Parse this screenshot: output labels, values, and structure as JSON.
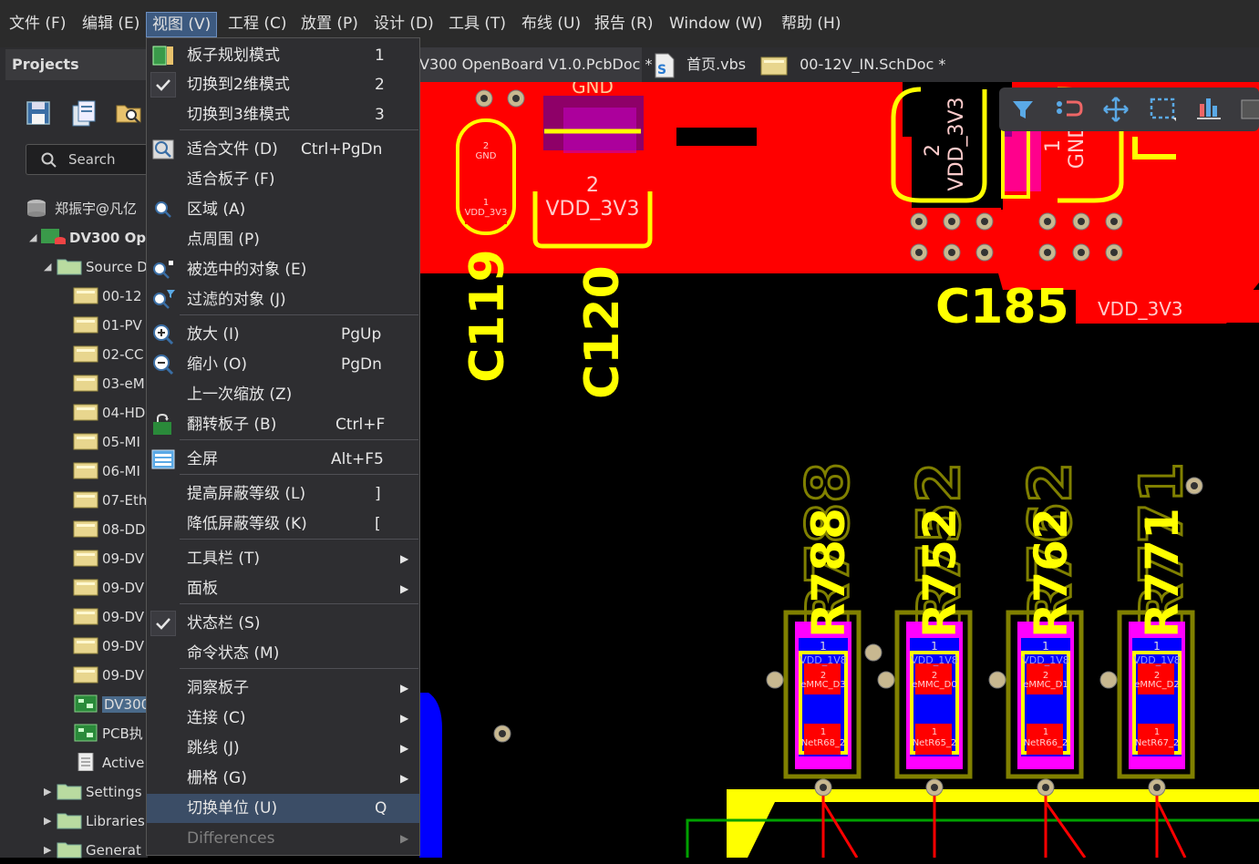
{
  "menubar": {
    "items": [
      "文件 (F)",
      "编辑 (E)",
      "视图 (V)",
      "工程 (C)",
      "放置 (P)",
      "设计 (D)",
      "工具 (T)",
      "布线 (U)",
      "报告 (R)",
      "Window (W)",
      "帮助 (H)"
    ]
  },
  "projects": {
    "title": "Projects",
    "search_placeholder": "Search",
    "tree": [
      {
        "label": "郑振宇@凡亿",
        "level": 0
      },
      {
        "label": "DV300 Op",
        "level": 1
      },
      {
        "label": "Source D",
        "level": 2
      },
      {
        "label": "00-12",
        "level": 3
      },
      {
        "label": "01-PV",
        "level": 3
      },
      {
        "label": "02-CC",
        "level": 3
      },
      {
        "label": "03-eM",
        "level": 3
      },
      {
        "label": "04-HD",
        "level": 3
      },
      {
        "label": "05-MI",
        "level": 3
      },
      {
        "label": "06-MI",
        "level": 3
      },
      {
        "label": "07-Eth",
        "level": 3
      },
      {
        "label": "08-DD",
        "level": 3
      },
      {
        "label": "09-DV",
        "level": 3
      },
      {
        "label": "09-DV",
        "level": 3
      },
      {
        "label": "09-DV",
        "level": 3
      },
      {
        "label": "09-DV",
        "level": 3
      },
      {
        "label": "09-DV",
        "level": 3
      },
      {
        "label": "DV300",
        "level": 3
      },
      {
        "label": "PCB执",
        "level": 3
      },
      {
        "label": "Active",
        "level": 3
      },
      {
        "label": "Settings",
        "level": 2
      },
      {
        "label": "Libraries",
        "level": 2
      },
      {
        "label": "Generat",
        "level": 2
      }
    ]
  },
  "doctabs": [
    "V300 OpenBoard V1.0.PcbDoc *",
    "首页.vbs",
    "00-12V_IN.SchDoc *"
  ],
  "view_menu": {
    "items": [
      {
        "label": "板子规划模式",
        "shortcut": "1"
      },
      {
        "label": "切换到2维模式",
        "shortcut": "2",
        "checked": true
      },
      {
        "label": "切换到3维模式",
        "shortcut": "3"
      },
      {
        "label": "适合文件 (D)",
        "shortcut": "Ctrl+PgDn"
      },
      {
        "label": "适合板子 (F)",
        "shortcut": ""
      },
      {
        "label": "区域 (A)",
        "shortcut": ""
      },
      {
        "label": "点周围 (P)",
        "shortcut": ""
      },
      {
        "label": "被选中的对象 (E)",
        "shortcut": ""
      },
      {
        "label": "过滤的对象 (J)",
        "shortcut": ""
      },
      {
        "label": "放大 (I)",
        "shortcut": "PgUp"
      },
      {
        "label": "缩小 (O)",
        "shortcut": "PgDn"
      },
      {
        "label": "上一次缩放 (Z)",
        "shortcut": ""
      },
      {
        "label": "翻转板子 (B)",
        "shortcut": "Ctrl+F"
      },
      {
        "label": "全屏",
        "shortcut": "Alt+F5"
      },
      {
        "label": "提高屏蔽等级 (L)",
        "shortcut": "]"
      },
      {
        "label": "降低屏蔽等级 (K)",
        "shortcut": "["
      },
      {
        "label": "工具栏 (T)",
        "shortcut": ""
      },
      {
        "label": "面板",
        "shortcut": ""
      },
      {
        "label": "状态栏 (S)",
        "shortcut": "",
        "checked": true
      },
      {
        "label": "命令状态 (M)",
        "shortcut": ""
      },
      {
        "label": "洞察板子",
        "shortcut": ""
      },
      {
        "label": "连接 (C)",
        "shortcut": ""
      },
      {
        "label": "跳线 (J)",
        "shortcut": ""
      },
      {
        "label": "栅格 (G)",
        "shortcut": ""
      },
      {
        "label": "切换单位 (U)",
        "shortcut": "Q"
      },
      {
        "label": "Differences",
        "shortcut": ""
      }
    ]
  },
  "pcb": {
    "labels": {
      "gnd_top": "GND",
      "c119_pad2": "2",
      "c119_gnd": "GND",
      "c119_pad1": "1",
      "c119_vdd": "VDD_3V3",
      "c120_pad": "2",
      "c120_vdd": "VDD_3V3",
      "c119": "C119",
      "c120": "C120",
      "c185": "C185",
      "vdd_right": "VDD_3V3",
      "vdd_vertical": "VDD_3V3",
      "vdd_vertical_num": "2",
      "gnd_vertical": "GND",
      "gnd_vertical_num": "1",
      "r788": "R788",
      "r752": "R752",
      "r762": "R762",
      "r771": "R771",
      "r788_bg": "R788",
      "r752_bg": "R752",
      "r762_bg": "R762",
      "r771_bg": "R771",
      "pad1": "1",
      "pad2": "2",
      "vdd_1v8": "VDD_1V8",
      "emmc_d3": "eMMC_D3",
      "emmc_d0": "eMMC_D0",
      "emmc_d1": "eMMC_D1",
      "emmc_d2": "eMMC_D2",
      "netr68": "NetR68_2",
      "netr65": "NetR65_2",
      "netr66": "NetR66_2",
      "netr67": "NetR67_2"
    }
  },
  "colors": {
    "copper_top": "#ff0000",
    "silk": "#ffff00",
    "bottom_layer": "#0000ff",
    "overlay": "#808000",
    "paste_mask": "#ff00ff"
  }
}
